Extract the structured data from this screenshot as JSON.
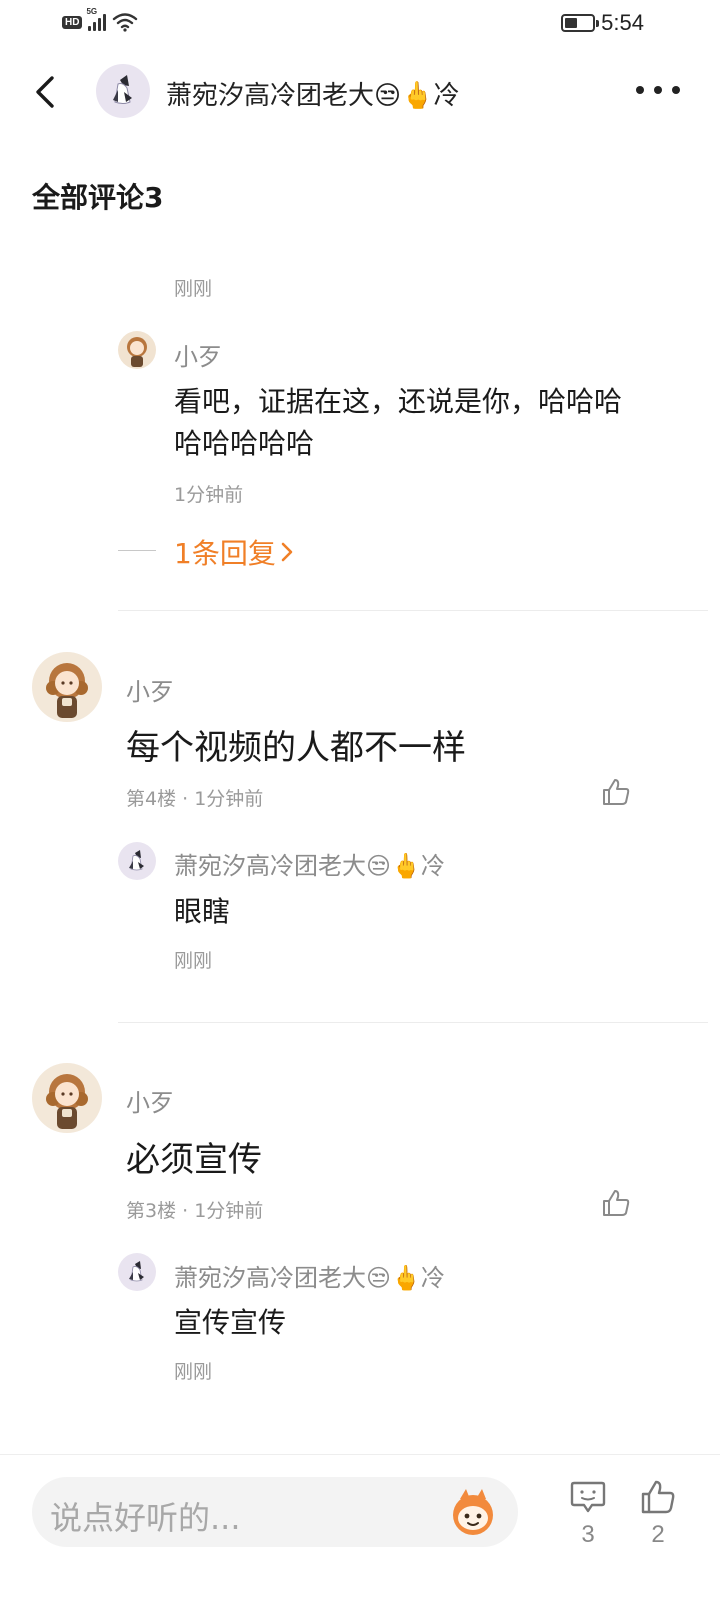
{
  "status_bar": {
    "hd": "HD",
    "network": "5G",
    "time": "5:54",
    "battery_level": 0.45
  },
  "header": {
    "title": "萧宛汐高冷团老大😒🖕冷"
  },
  "section_title": "全部评论3",
  "top_fragment": {
    "time": "刚刚"
  },
  "thread1": {
    "reply": {
      "author": "小歹",
      "text_line1": "看吧，证据在这，还说是你，哈哈哈",
      "text_line2": "哈哈哈哈哈",
      "time": "1分钟前"
    },
    "more_replies": "1条回复"
  },
  "comment4": {
    "author": "小歹",
    "text": "每个视频的人都不一样",
    "meta": "第4楼 · 1分钟前",
    "reply": {
      "author": "萧宛汐高冷团老大😒🖕冷",
      "text": "眼瞎",
      "time": "刚刚"
    }
  },
  "comment3": {
    "author": "小歹",
    "text": "必须宣传",
    "meta": "第3楼 · 1分钟前",
    "reply": {
      "author": "萧宛汐高冷团老大😒🖕冷",
      "text": "宣传宣传",
      "time": "刚刚"
    }
  },
  "bottom_bar": {
    "placeholder": "说点好听的...",
    "comment_count": "3",
    "like_count": "2"
  },
  "colors": {
    "accent": "#f07f27",
    "muted": "#9a9a9a"
  }
}
